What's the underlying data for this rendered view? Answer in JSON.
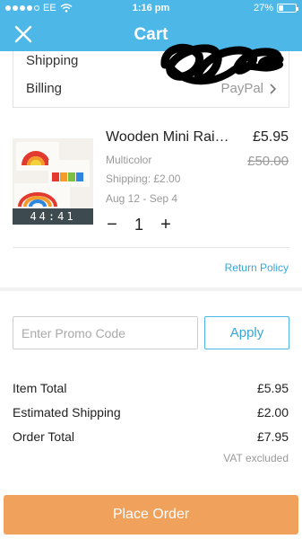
{
  "status_bar": {
    "carrier": "EE",
    "time": "1:16 pm",
    "battery": "27%",
    "battery_level": 0.27
  },
  "nav": {
    "title": "Cart"
  },
  "addresses": {
    "shipping_label": "Shipping",
    "billing_label": "Billing",
    "billing_value": "PayPal"
  },
  "product": {
    "name": "Wooden Mini Rai…",
    "price": "£5.95",
    "old_price": "£50.00",
    "color": "Multicolor",
    "shipping": "Shipping: £2.00",
    "dates": "Aug 12 - Sep 4",
    "timer": "44:41",
    "quantity": "1",
    "minus": "−",
    "plus": "+",
    "return_policy": "Return Policy"
  },
  "promo": {
    "placeholder": "Enter Promo Code",
    "apply_label": "Apply"
  },
  "totals": {
    "item_total_label": "Item Total",
    "item_total_value": "£5.95",
    "shipping_label": "Estimated Shipping",
    "shipping_value": "£2.00",
    "order_total_label": "Order Total",
    "order_total_value": "£7.95",
    "vat_note": "VAT excluded"
  },
  "actions": {
    "place_order": "Place Order"
  },
  "colors": {
    "header": "#4db8e8",
    "accent": "#38a7d8",
    "cta": "#f0a25d"
  }
}
